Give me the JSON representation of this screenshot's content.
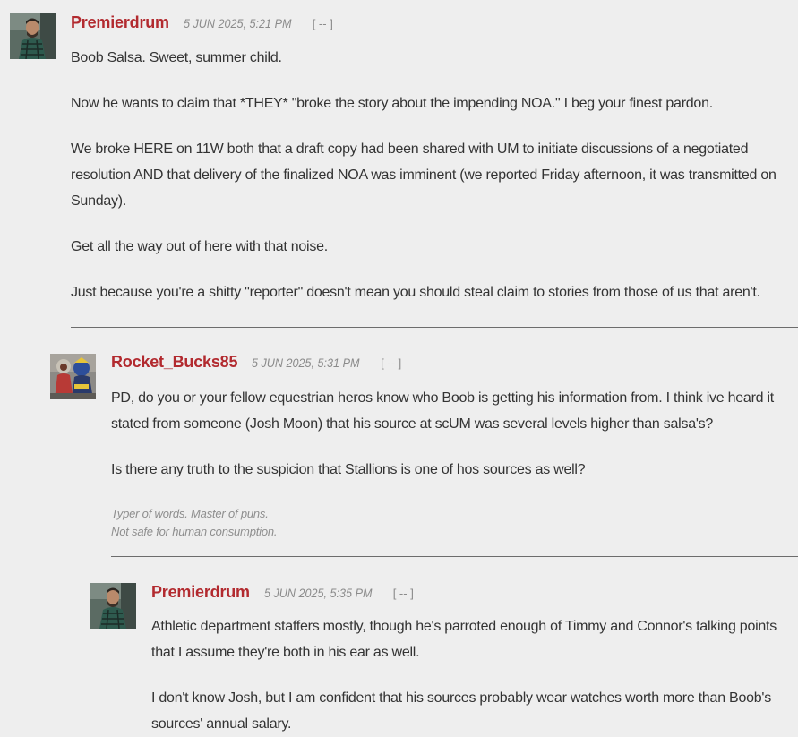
{
  "comments": [
    {
      "author": "Premierdrum",
      "date": "5 JUN 2025, 5:21 PM",
      "collapse": "[ -- ]",
      "paragraphs": [
        "Boob Salsa. Sweet, summer child.",
        "Now he wants to claim that *THEY* \"broke the story about the impending NOA.\" I beg your finest pardon.",
        "We broke HERE on 11W both that a draft copy had been shared with UM to initiate discussions of a negotiated resolution AND that delivery of the finalized NOA was imminent (we reported Friday afternoon, it was transmitted on Sunday).",
        "Get all the way out of here with that noise.",
        "Just because you're a shitty \"reporter\" doesn't mean you should steal claim to stories from those of us that aren't."
      ]
    },
    {
      "author": "Rocket_Bucks85",
      "date": "5 JUN 2025, 5:31 PM",
      "collapse": "[ -- ]",
      "paragraphs": [
        "PD, do you or your fellow equestrian heros know who Boob is getting his information from. I think ive heard it stated from someone (Josh Moon) that his source at scUM was several levels higher than salsa's?",
        "Is there any truth to the suspicion that Stallions is one of hos sources as well?"
      ],
      "signature": [
        "Typer of words. Master of puns.",
        "Not safe for human consumption."
      ]
    },
    {
      "author": "Premierdrum",
      "date": "5 JUN 2025, 5:35 PM",
      "collapse": "[ -- ]",
      "paragraphs": [
        "Athletic department staffers mostly, though he's parroted enough of Timmy and Connor's talking points that I assume they're both in his ear as well.",
        "I don't know Josh, but I am confident that his sources probably wear watches worth more than Boob's sources' annual salary."
      ]
    }
  ]
}
